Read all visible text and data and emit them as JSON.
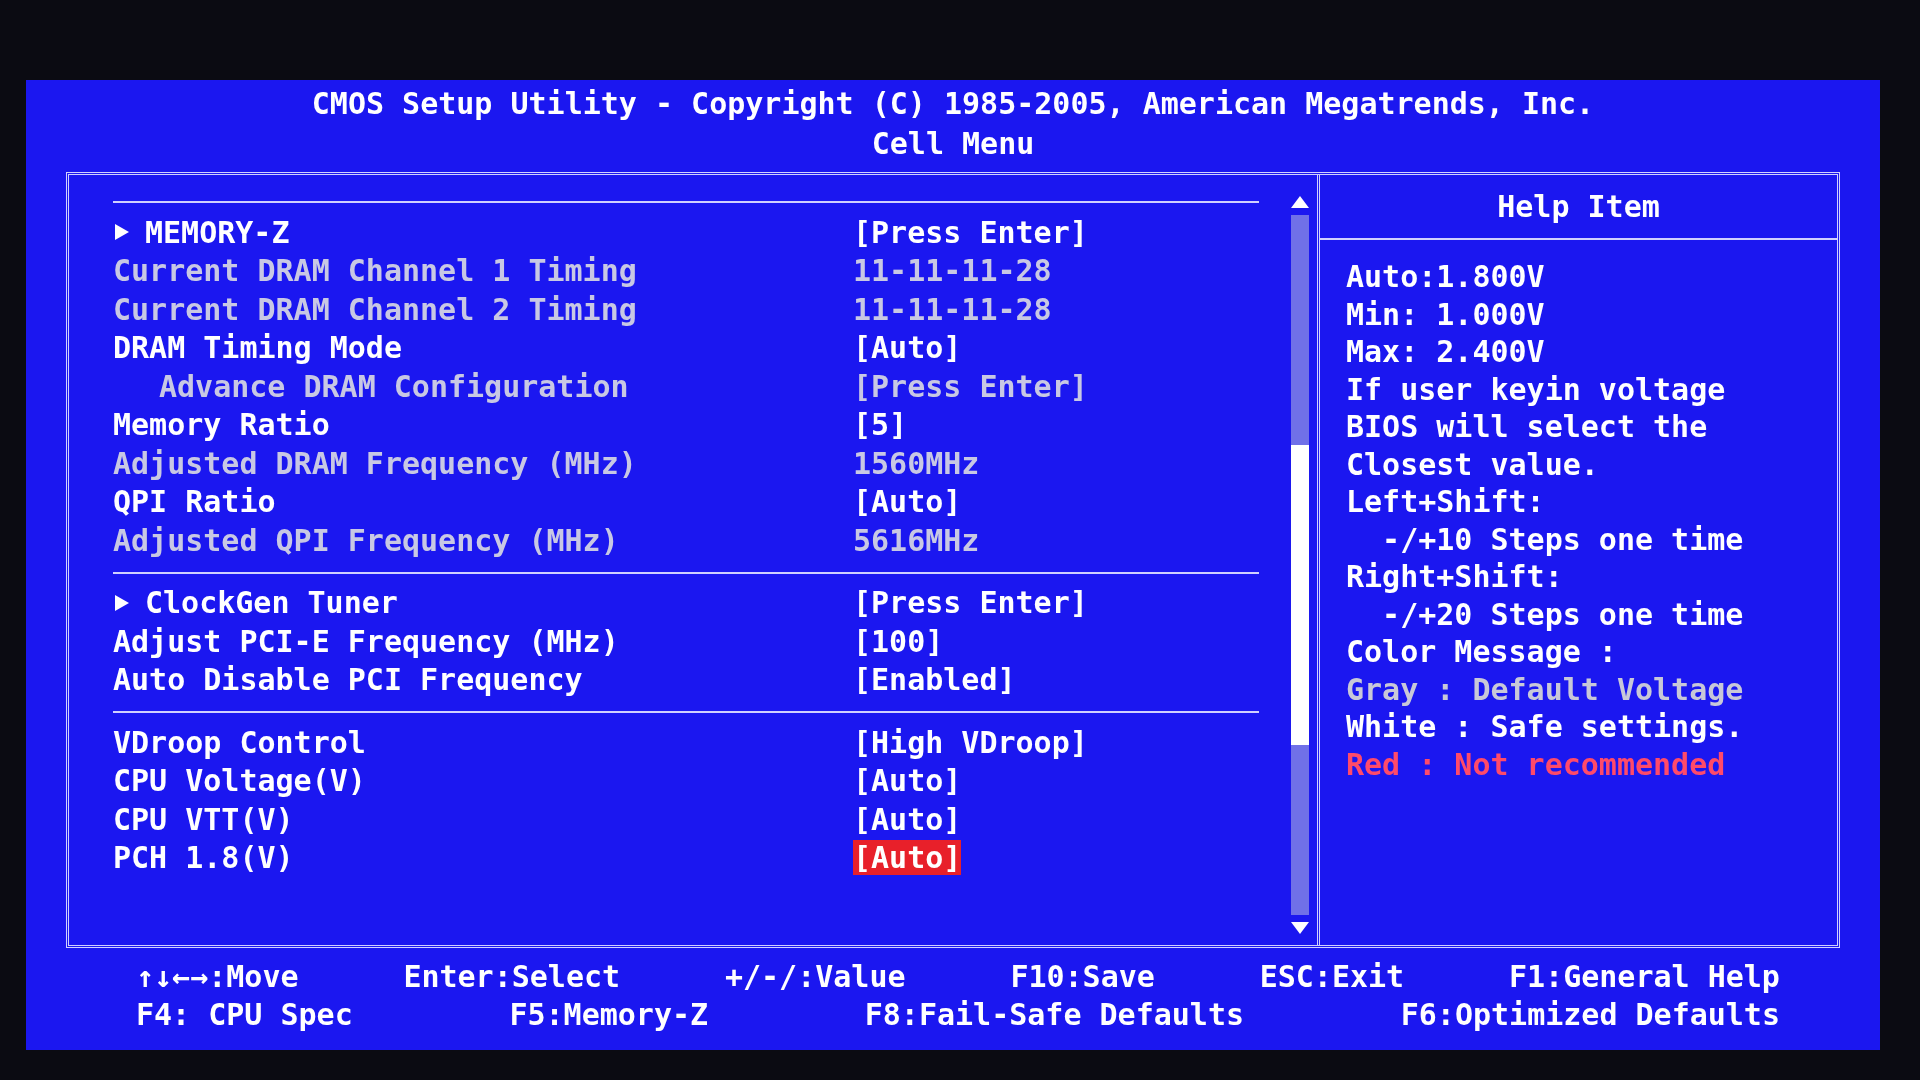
{
  "header": {
    "title": "CMOS Setup Utility - Copyright (C) 1985-2005, American Megatrends, Inc.",
    "subtitle": "Cell Menu"
  },
  "sections": [
    {
      "items": [
        {
          "kind": "submenu",
          "label": "MEMORY-Z",
          "value": "[Press Enter]",
          "selected": false
        },
        {
          "kind": "info",
          "label": "Current DRAM Channel 1 Timing",
          "value": "11-11-11-28",
          "selected": false
        },
        {
          "kind": "info",
          "label": "Current DRAM Channel 2 Timing",
          "value": "11-11-11-28",
          "selected": false
        },
        {
          "kind": "setting",
          "label": "DRAM Timing Mode",
          "value": "[Auto]",
          "selected": false,
          "children": [
            {
              "kind": "info",
              "label": "Advance DRAM Configuration",
              "value": "[Press Enter]",
              "selected": false
            }
          ]
        },
        {
          "kind": "setting",
          "label": "Memory Ratio",
          "value": "[5]",
          "selected": false
        },
        {
          "kind": "info",
          "label": "Adjusted DRAM Frequency (MHz)",
          "value": "1560MHz",
          "selected": false
        },
        {
          "kind": "setting",
          "label": "QPI Ratio",
          "value": "[Auto]",
          "selected": false
        },
        {
          "kind": "info",
          "label": "Adjusted QPI Frequency (MHz)",
          "value": "5616MHz",
          "selected": false
        }
      ]
    },
    {
      "items": [
        {
          "kind": "submenu",
          "label": "ClockGen Tuner",
          "value": "[Press Enter]",
          "selected": false
        },
        {
          "kind": "setting",
          "label": "Adjust PCI-E Frequency (MHz)",
          "value": "[100]",
          "selected": false
        },
        {
          "kind": "setting",
          "label": "Auto Disable PCI Frequency",
          "value": "[Enabled]",
          "selected": false
        }
      ]
    },
    {
      "items": [
        {
          "kind": "setting",
          "label": "VDroop Control",
          "value": "[High VDroop]",
          "selected": false
        },
        {
          "kind": "setting",
          "label": "CPU Voltage(V)",
          "value": "[Auto]",
          "selected": false
        },
        {
          "kind": "setting",
          "label": "CPU VTT(V)",
          "value": "[Auto]",
          "selected": false
        },
        {
          "kind": "setting",
          "label": "PCH 1.8(V)",
          "value": "[Auto]",
          "selected": true
        }
      ]
    }
  ],
  "help": {
    "title": "Help Item",
    "lines": [
      {
        "text": "Auto:1.800V",
        "color": "#ffffff"
      },
      {
        "text": "Min: 1.000V",
        "color": "#ffffff"
      },
      {
        "text": "Max: 2.400V",
        "color": "#ffffff"
      },
      {
        "text": "If user keyin voltage",
        "color": "#ffffff"
      },
      {
        "text": "BIOS will select the",
        "color": "#ffffff"
      },
      {
        "text": "Closest value.",
        "color": "#ffffff"
      },
      {
        "text": "Left+Shift:",
        "color": "#ffffff"
      },
      {
        "text": "  -/+10 Steps one time",
        "color": "#ffffff"
      },
      {
        "text": "Right+Shift:",
        "color": "#ffffff"
      },
      {
        "text": "  -/+20 Steps one time",
        "color": "#ffffff"
      },
      {
        "text": "Color Message :",
        "color": "#ffffff"
      },
      {
        "text": "Gray : Default Voltage",
        "color": "#c8c8d8"
      },
      {
        "text": "White : Safe settings.",
        "color": "#ffffff"
      },
      {
        "text": "Red : Not recommended",
        "color": "#ff4a6a"
      }
    ]
  },
  "footer": [
    [
      "↑↓←→:Move",
      "Enter:Select",
      "+/-/:Value",
      "F10:Save",
      "ESC:Exit",
      "F1:General Help"
    ],
    [
      "F4: CPU Spec",
      "F5:Memory-Z",
      "F8:Fail-Safe Defaults",
      "F6:Optimized Defaults"
    ]
  ]
}
